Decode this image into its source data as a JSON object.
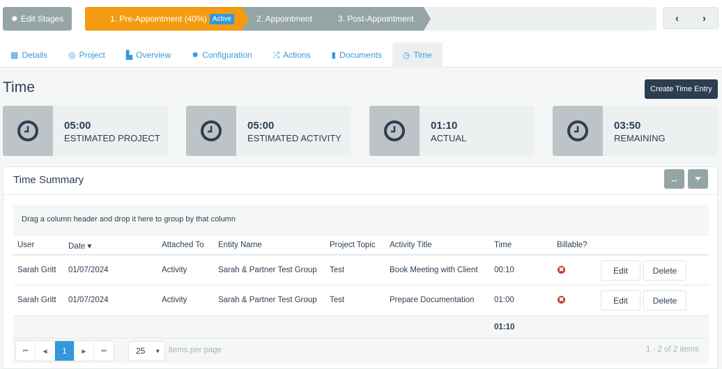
{
  "toolbar": {
    "edit_stages": "Edit Stages",
    "prev": "‹",
    "next": "›"
  },
  "stages": [
    {
      "label": "1. Pre-Appointment (40%)",
      "badge": "Active"
    },
    {
      "label": "2. Appointment"
    },
    {
      "label": "3. Post-Appointment"
    }
  ],
  "tabs": [
    {
      "label": "Details",
      "icon": "▦"
    },
    {
      "label": "Project",
      "icon": "◎"
    },
    {
      "label": "Overview",
      "icon": "▙"
    },
    {
      "label": "Configuration",
      "icon": "✹"
    },
    {
      "label": "Actions",
      "icon": "⤮"
    },
    {
      "label": "Documents",
      "icon": "▮"
    },
    {
      "label": "Time",
      "icon": "◷"
    }
  ],
  "page": {
    "title": "Time",
    "create_button": "Create Time Entry"
  },
  "cards": [
    {
      "value": "05:00",
      "label": "ESTIMATED PROJECT"
    },
    {
      "value": "05:00",
      "label": "ESTIMATED ACTIVITY"
    },
    {
      "value": "01:10",
      "label": "ACTUAL"
    },
    {
      "value": "03:50",
      "label": "REMAINING"
    }
  ],
  "summary": {
    "title": "Time Summary",
    "group_hint": "Drag a column header and drop it here to group by that column",
    "columns": [
      "User",
      "Date ▾",
      "Attached To",
      "Entity Name",
      "Project Topic",
      "Activity Title",
      "Time",
      "Billable?"
    ],
    "rows": [
      [
        "Sarah Gritt",
        "01/07/2024",
        "Activity",
        "Sarah & Partner Test Group",
        "Test",
        "Book Meeting with Client",
        "00:10"
      ],
      [
        "Sarah Gritt",
        "01/07/2024",
        "Activity",
        "Sarah & Partner Test Group",
        "Test",
        "Prepare Documentation",
        "01:00"
      ]
    ],
    "billable_icon": "✖",
    "edit": "Edit",
    "delete": "Delete",
    "total": "01:10",
    "pager": {
      "first": "⏮",
      "prev": "◀",
      "page": "1",
      "next": "▶",
      "last": "⏭",
      "page_size": "25",
      "per_page": "items per page",
      "info": "1 - 2 of 2 items"
    }
  }
}
